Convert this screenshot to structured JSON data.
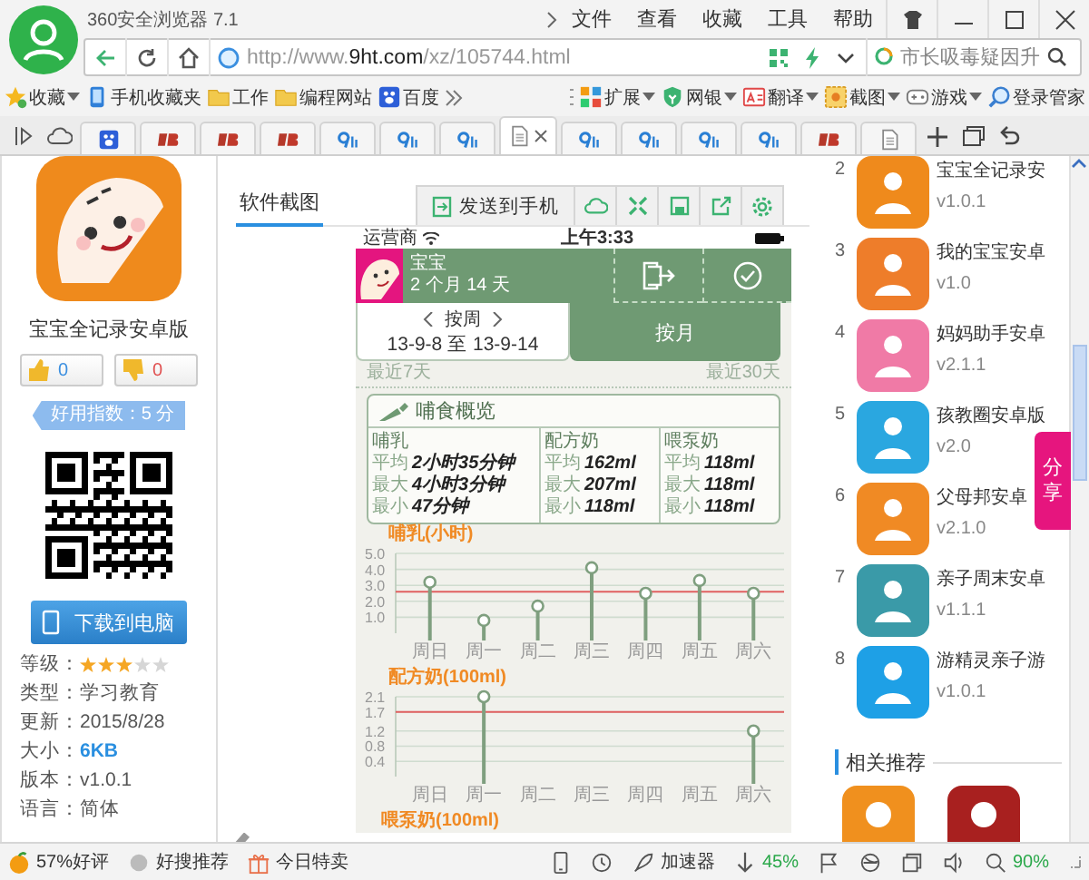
{
  "window": {
    "title": "360安全浏览器 7.1"
  },
  "menu": [
    {
      "label": "文件"
    },
    {
      "label": "查看"
    },
    {
      "label": "收藏"
    },
    {
      "label": "工具"
    },
    {
      "label": "帮助"
    }
  ],
  "address_bar": {
    "url": {
      "scheme": "http://www.",
      "domain": "9ht.com",
      "path": "/xz/105744.html"
    },
    "search_placeholder": "市长吸毒疑因升"
  },
  "bookmarks": [
    {
      "label": "收藏",
      "kind": "star",
      "menu": true
    },
    {
      "label": "手机收藏夹",
      "kind": "phone",
      "menu": false
    },
    {
      "label": "工作",
      "kind": "folder",
      "menu": false
    },
    {
      "label": "编程网站",
      "kind": "folder",
      "menu": false
    },
    {
      "label": "百度",
      "kind": "paw",
      "menu": false
    }
  ],
  "extensions": [
    {
      "label": "扩展",
      "kind": "grid",
      "menu": true
    },
    {
      "label": "网银",
      "kind": "shield",
      "menu": true
    },
    {
      "label": "翻译",
      "kind": "translate",
      "menu": true
    },
    {
      "label": "截图",
      "kind": "crop",
      "menu": true
    },
    {
      "label": "游戏",
      "kind": "gamepad",
      "menu": true
    },
    {
      "label": "登录管家",
      "kind": "magnifier",
      "menu": false
    }
  ],
  "tabs": [
    {
      "kind": "paw",
      "selected": false
    },
    {
      "kind": "red",
      "selected": false
    },
    {
      "kind": "red",
      "selected": false
    },
    {
      "kind": "red",
      "selected": false
    },
    {
      "kind": "blue",
      "selected": false
    },
    {
      "kind": "blue",
      "selected": false
    },
    {
      "kind": "blue",
      "selected": false
    },
    {
      "kind": "page",
      "selected": true
    },
    {
      "kind": "blue",
      "selected": false
    },
    {
      "kind": "blue",
      "selected": false
    },
    {
      "kind": "blue",
      "selected": false
    },
    {
      "kind": "blue",
      "selected": false
    },
    {
      "kind": "red",
      "selected": false
    },
    {
      "kind": "page",
      "selected": false
    }
  ],
  "app": {
    "name": "宝宝全记录安卓版",
    "likes": "0",
    "dislikes": "0",
    "score": "好用指数：5 分",
    "download": "下载到电脑",
    "info": [
      {
        "kind": "stars",
        "label": "等级：",
        "stars": 3
      },
      {
        "kind": "text",
        "label": "类型：",
        "value": "学习教育"
      },
      {
        "kind": "text",
        "label": "更新：",
        "value": "2015/8/28"
      },
      {
        "kind": "highlight",
        "label": "大小：",
        "value": "6KB"
      },
      {
        "kind": "text",
        "label": "版本：",
        "value": "v1.0.1"
      },
      {
        "kind": "text",
        "label": "语言：",
        "value": "简体"
      }
    ]
  },
  "screenshots": {
    "tab": "软件截图",
    "send_button": "发送到手机"
  },
  "phone": {
    "status": {
      "carrier": "运营商",
      "time": "上午3:33"
    },
    "baby": {
      "name": "宝宝",
      "age": "2 个月 14 天"
    },
    "periods": [
      {
        "label": "按周",
        "range": "13-9-8 至 13-9-14",
        "selected": true
      },
      {
        "label": "按月",
        "selected": false
      }
    ],
    "recent": [
      "最近7天",
      "最近30天"
    ],
    "overview": {
      "title": "哺食概览",
      "columns": [
        {
          "title": "哺乳",
          "rows": [
            {
              "label": "平均",
              "value": "2小时35分钟"
            },
            {
              "label": "最大",
              "value": "4小时3分钟"
            },
            {
              "label": "最小",
              "value": "47分钟"
            }
          ]
        },
        {
          "title": "配方奶",
          "rows": [
            {
              "label": "平均",
              "value": "162ml"
            },
            {
              "label": "最大",
              "value": "207ml"
            },
            {
              "label": "最小",
              "value": "118ml"
            }
          ]
        },
        {
          "title": "喂泵奶",
          "rows": [
            {
              "label": "平均",
              "value": "118ml"
            },
            {
              "label": "最大",
              "value": "118ml"
            },
            {
              "label": "最小",
              "value": "118ml"
            }
          ]
        }
      ]
    },
    "charts": [
      {
        "chart_data": {
          "type": "scatter",
          "title": "哺乳(小时)",
          "categories": [
            "周日",
            "周一",
            "周二",
            "周三",
            "周四",
            "周五",
            "周六"
          ],
          "values": [
            3.2,
            0.8,
            1.7,
            4.1,
            2.5,
            3.3,
            2.5
          ],
          "grid": true,
          "ylim": [
            0,
            5
          ],
          "yticks": [
            {
              "value": 1,
              "label": "1.0"
            },
            {
              "value": 2,
              "label": "2.0"
            },
            {
              "value": 3,
              "label": "3.0"
            },
            {
              "value": 4,
              "label": "4.0"
            },
            {
              "value": 5,
              "label": "5.0"
            }
          ],
          "ref_lines": [
            {
              "axis": "y",
              "value": 2.6
            }
          ]
        }
      },
      {
        "chart_data": {
          "type": "scatter",
          "title": "配方奶(100ml)",
          "categories": [
            "周日",
            "周一",
            "周二",
            "周三",
            "周四",
            "周五",
            "周六"
          ],
          "values": [
            null,
            2.1,
            null,
            null,
            null,
            null,
            1.2
          ],
          "grid": true,
          "ylim": [
            0,
            2.1
          ],
          "yticks": [
            0.4,
            0.8,
            1.2,
            1.7,
            2.1
          ],
          "ref_lines": [
            {
              "axis": "y",
              "value": 1.7
            }
          ]
        }
      }
    ],
    "next_chart_title": "喂泵奶(100ml)"
  },
  "ranking": [
    {
      "rank": "2",
      "name": "宝宝全记录安",
      "version": "v1.0.1",
      "color": "#ef8a1c"
    },
    {
      "rank": "3",
      "name": "我的宝宝安卓",
      "version": "v1.0",
      "color": "#ee7d2a"
    },
    {
      "rank": "4",
      "name": "妈妈助手安卓",
      "version": "v2.1.1",
      "color": "#f07aa6"
    },
    {
      "rank": "5",
      "name": "孩教圈安卓版",
      "version": "v2.0",
      "color": "#2aa7e0"
    },
    {
      "rank": "6",
      "name": "父母邦安卓",
      "version": "v2.1.0",
      "color": "#f08a24"
    },
    {
      "rank": "7",
      "name": "亲子周末安卓",
      "version": "v1.1.1",
      "color": "#3a9aa8"
    },
    {
      "rank": "8",
      "name": "游精灵亲子游",
      "version": "v1.0.1",
      "color": "#1ea0e6"
    }
  ],
  "related": {
    "title": "相关推荐",
    "items": [
      {
        "color": "#f0901e"
      },
      {
        "color": "#a8201f"
      }
    ]
  },
  "share": "分享",
  "status_bar": {
    "left": [
      {
        "kind": "orange",
        "label": "57%好评"
      },
      {
        "kind": "dot",
        "label": "好搜推荐"
      },
      {
        "kind": "gift",
        "label": "今日特卖"
      }
    ],
    "right": [
      {
        "kind": "phone"
      },
      {
        "kind": "clock"
      },
      {
        "kind": "rocket",
        "label": "加速器"
      },
      {
        "kind": "download",
        "label": "45%"
      },
      {
        "kind": "flag"
      },
      {
        "kind": "ie"
      },
      {
        "kind": "window"
      },
      {
        "kind": "speaker"
      },
      {
        "kind": "zoom",
        "label": "90%"
      }
    ]
  }
}
